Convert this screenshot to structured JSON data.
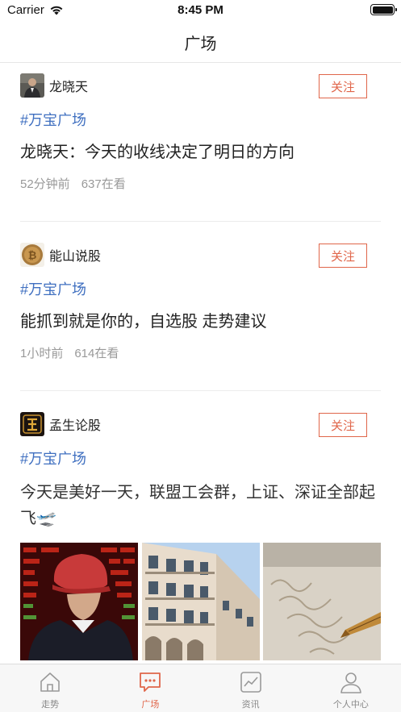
{
  "status_bar": {
    "carrier": "Carrier",
    "time": "8:45 PM",
    "battery_level": 1.0
  },
  "nav": {
    "title": "广场"
  },
  "colors": {
    "accent": "#e0664a",
    "tag": "#3f6fc0",
    "meta": "#999999"
  },
  "posts": [
    {
      "author": "龙晓天",
      "follow_label": "关注",
      "tag": "#万宝广场",
      "title": "龙晓天：今天的收线决定了明日的方向",
      "time": "52分钟前",
      "views": "637在看"
    },
    {
      "author": "能山说股",
      "follow_label": "关注",
      "tag": "#万宝广场",
      "title": "能抓到就是你的，自选股 走势建议",
      "time": "1小时前",
      "views": "614在看"
    },
    {
      "author": "孟生论股",
      "follow_label": "关注",
      "tag": "#万宝广场",
      "title": "今天是美好一天，联盟工会群，上证、深证全部起飞🛫"
    }
  ],
  "tabs": [
    {
      "label": "走势",
      "icon": "home-icon",
      "active": false
    },
    {
      "label": "广场",
      "icon": "chat-icon",
      "active": true
    },
    {
      "label": "资讯",
      "icon": "chart-icon",
      "active": false
    },
    {
      "label": "个人中心",
      "icon": "person-icon",
      "active": false
    }
  ]
}
